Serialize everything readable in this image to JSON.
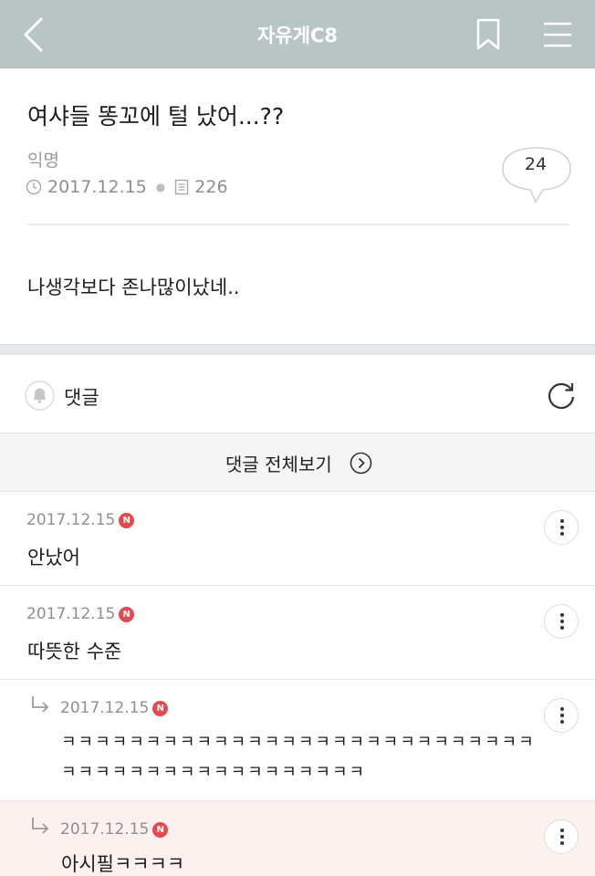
{
  "header": {
    "title": "자유게C8",
    "icons": [
      "back-icon",
      "bookmark-icon",
      "menu-icon"
    ]
  },
  "post": {
    "title": "여샤들 똥꼬에 털 났어...??",
    "author": "익명",
    "date": "2017.12.15",
    "views": "226",
    "comment_count": "24",
    "body": "나생각보다 존나많이났네.."
  },
  "comments_section": {
    "label": "댓글",
    "view_all_label": "댓글 전체보기"
  },
  "comments": [
    {
      "date": "2017.12.15",
      "badge": "N",
      "text": "안났어",
      "reply": false
    },
    {
      "date": "2017.12.15",
      "badge": "N",
      "text": "따뜻한 수준",
      "reply": false
    },
    {
      "date": "2017.12.15",
      "badge": "N",
      "text": "ㅋㅋㅋㅋㅋㅋㅋㅋㅋㅋㅋㅋㅋㅋㅋㅋㅋㅋㅋㅋㅋㅋㅋㅋㅋㅋㅋㅋㅋㅋㅋㅋㅋㅋㅋㅋㅋㅋㅋㅋㅋㅋㅋㅋㅋㅋ",
      "reply": true
    },
    {
      "date": "2017.12.15",
      "badge": "N",
      "text": "아시필ㅋㅋㅋㅋ",
      "reply": true
    }
  ],
  "colors": {
    "header_bg": "#b9c5c5",
    "badge": "#e5484d",
    "highlight_bg": "#fcf1ef"
  }
}
